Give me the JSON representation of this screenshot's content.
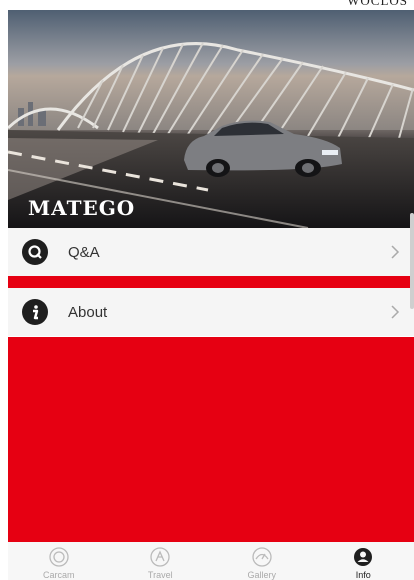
{
  "header": {
    "top_clip": "WOCLOS"
  },
  "hero": {
    "brand": "MATEGO"
  },
  "menu": [
    {
      "label": "Q&A",
      "icon": "q-icon"
    },
    {
      "label": "About",
      "icon": "info-icon"
    }
  ],
  "accent_color": "#e60012",
  "tabs": [
    {
      "label": "Carcam",
      "icon": "camera-lens-icon",
      "active": false
    },
    {
      "label": "Travel",
      "icon": "route-icon",
      "active": false
    },
    {
      "label": "Gallery",
      "icon": "gauge-icon",
      "active": false
    },
    {
      "label": "Info",
      "icon": "user-icon",
      "active": true
    }
  ]
}
